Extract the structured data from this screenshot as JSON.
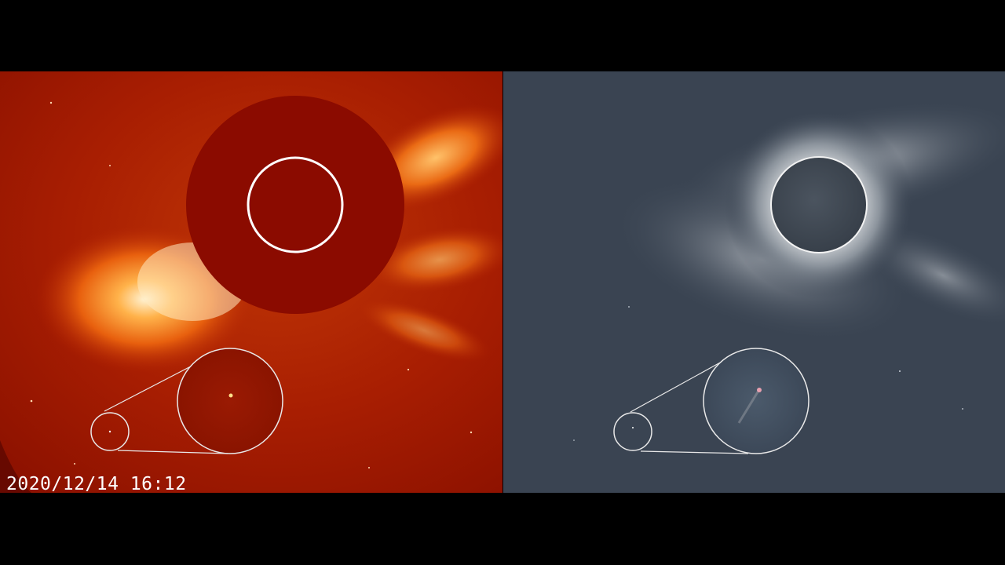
{
  "left_panel": {
    "timestamp": "2020/12/14 16:12"
  },
  "colors": {
    "background": "#000000",
    "left_base": "#a81e02",
    "left_occulter": "#8b0b00",
    "right_base": "#3a4452",
    "right_moon": "#414a55",
    "overlay_lines": "#e9e9e9"
  }
}
